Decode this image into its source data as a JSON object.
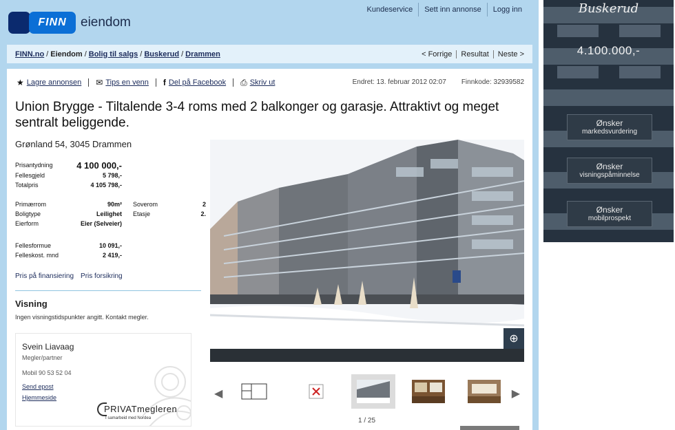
{
  "header": {
    "logo_text": "FINN",
    "logo_suffix": "eiendom",
    "top_links": [
      "Kundeservice",
      "Sett inn annonse",
      "Logg inn"
    ]
  },
  "breadcrumb": {
    "items": [
      "FINN.no",
      "Eiendom",
      "Bolig til salgs",
      "Buskerud",
      "Drammen"
    ],
    "separator": "/",
    "pager": [
      "< Forrige",
      "Resultat",
      "Neste >"
    ]
  },
  "actions": {
    "save": "Lagre annonsen",
    "tip": "Tips en venn",
    "facebook": "Del på Facebook",
    "print": "Skriv ut",
    "changed": "Endret:  13. februar 2012 02:07",
    "finnkode": "Finnkode:  32939582"
  },
  "listing": {
    "title": "Union Brygge - Tiltalende 3-4 roms med 2 balkonger og garasje. Attraktivt og meget sentralt beliggende.",
    "address": "Grønland 54, 3045 Drammen",
    "price": [
      {
        "k": "Prisantydning",
        "v": "4 100 000,-"
      },
      {
        "k": "Fellesgjeld",
        "v": "5 798,-"
      },
      {
        "k": "Totalpris",
        "v": "4 105 798,-"
      }
    ],
    "facts_left": [
      {
        "k": "Primærrom",
        "v": "90m²"
      },
      {
        "k": "Boligtype",
        "v": "Leilighet"
      },
      {
        "k": "Eierform",
        "v": "Eier (Selveier)"
      }
    ],
    "facts_right": [
      {
        "k": "Soverom",
        "v": "2"
      },
      {
        "k": "Etasje",
        "v": "2."
      }
    ],
    "costs": [
      {
        "k": "Fellesformue",
        "v": "10 091,-"
      },
      {
        "k": "Felleskost. mnd",
        "v": "2 419,-"
      }
    ],
    "finance_links": [
      "Pris på finansiering",
      "Pris forsikring"
    ]
  },
  "visning": {
    "title": "Visning",
    "text": "Ingen visningstidspunkter angitt. Kontakt megler."
  },
  "agent": {
    "name": "Svein Liavaag",
    "role": "Megler/partner",
    "phone": "Mobil  90 53 52 04",
    "email": "Send epost",
    "homepage": "Hjemmeside",
    "company": "PRIVATmegleren",
    "company_sub": "I samarbeid med Nordea"
  },
  "gallery": {
    "counter": "1 / 25"
  },
  "ad": {
    "region": "Buskerud",
    "price": "4.100.000,-",
    "buttons": [
      {
        "l1": "Ønsker",
        "l2": "markedsvurdering"
      },
      {
        "l1": "Ønsker",
        "l2": "visningspåminnelse"
      },
      {
        "l1": "Ønsker",
        "l2": "mobilprospekt"
      }
    ]
  },
  "colors": {
    "frame": "#b2d6ee",
    "breadcrumb_bg": "#e3f1fa",
    "link": "#1a2a5a",
    "logo_dark": "#0b2a6e",
    "logo_blue": "#0b6fd6",
    "ad_bg": "#1c2a3a"
  }
}
